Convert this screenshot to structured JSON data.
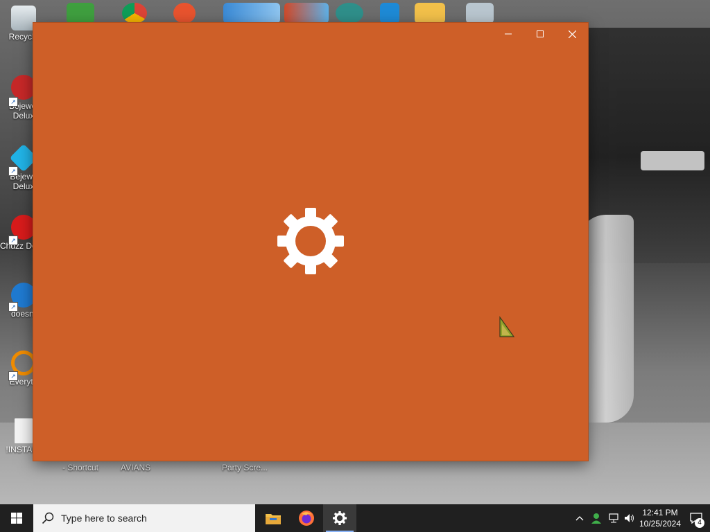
{
  "desktop": {
    "icons": [
      {
        "label": "Recycle"
      },
      {
        "label": "Bejewel Delux"
      },
      {
        "label": "Bejewe Delux"
      },
      {
        "label": "Chuzz Delux"
      },
      {
        "label": "doesnt"
      },
      {
        "label": "Everyth"
      },
      {
        "label": "!INSTALL"
      }
    ],
    "below_window_labels": [
      "- Shortcut",
      "AVIANS",
      "Party Scre..."
    ]
  },
  "window": {
    "background_color": "#ce5f28",
    "minimize_icon": "minimize-icon",
    "maximize_icon": "maximize-icon",
    "close_icon": "close-icon",
    "splash_icon": "gear-icon"
  },
  "taskbar": {
    "search_placeholder": "Type here to search",
    "apps": [
      "file-explorer",
      "firefox",
      "settings"
    ],
    "active_app": "settings",
    "clock_time": "12:41 PM",
    "clock_date": "10/25/2024",
    "notification_count": "4"
  }
}
